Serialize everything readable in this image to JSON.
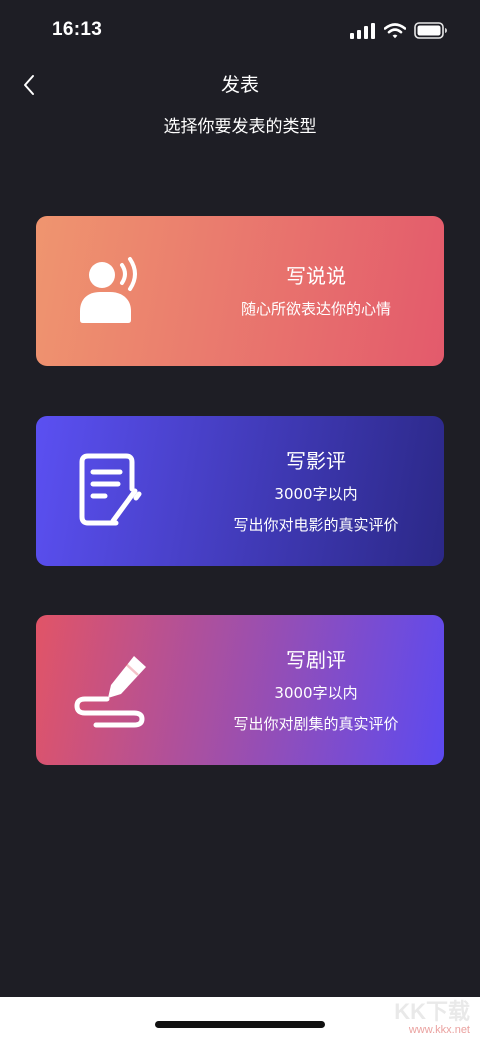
{
  "status_bar": {
    "time": "16:13",
    "icons": [
      "signal-icon",
      "wifi-icon",
      "battery-icon"
    ]
  },
  "nav": {
    "back_icon": "chevron-left-icon",
    "title": "发表",
    "subtitle": "选择你要发表的类型"
  },
  "cards": [
    {
      "icon": "speaking-person-icon",
      "title": "写说说",
      "lines": [
        "随心所欲表达你的心情"
      ],
      "gradient": [
        "#ef956f",
        "#e35a6c"
      ]
    },
    {
      "icon": "edit-document-icon",
      "title": "写影评",
      "lines": [
        "3000字以内",
        "写出你对电影的真实评价"
      ],
      "gradient": [
        "#5b50f2",
        "#2b2887"
      ]
    },
    {
      "icon": "pen-scribble-icon",
      "title": "写剧评",
      "lines": [
        "3000字以内",
        "写出你对剧集的真实评价"
      ],
      "gradient": [
        "#e15467",
        "#5c4af0"
      ]
    }
  ],
  "colors": {
    "background": "#1e1e25",
    "text": "#ffffff",
    "bottom_bar": "#ffffff",
    "home_indicator": "#111111"
  },
  "watermark": {
    "logo": "KK下载",
    "url": "www.kkx.net"
  }
}
